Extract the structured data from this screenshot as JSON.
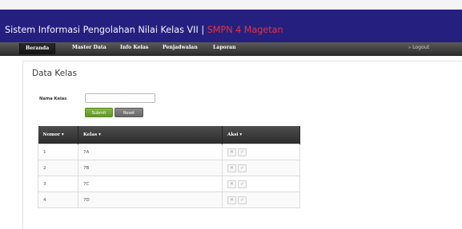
{
  "header": {
    "title": "Sistem Informasi Pengolahan Nilai Kelas VII",
    "separator": "|",
    "school": "SMPN 4 Magetan"
  },
  "nav": {
    "items": [
      "Beranda",
      "Master Data",
      "Info Kelas",
      "Penjadwalan",
      "Laporan"
    ],
    "logout": "Logout"
  },
  "page": {
    "title": "Data Kelas"
  },
  "form": {
    "label": "Nama Kelas",
    "value": "",
    "submit": "Submit",
    "reset": "Reset"
  },
  "table": {
    "headers": [
      "Nomor ▾",
      "Kelas ▾",
      "Aksi ▾"
    ],
    "rows": [
      [
        "1",
        "7A"
      ],
      [
        "2",
        "7B"
      ],
      [
        "3",
        "7C"
      ],
      [
        "4",
        "7D"
      ]
    ],
    "delete_icon": "x-icon",
    "edit_icon": "check-icon"
  }
}
